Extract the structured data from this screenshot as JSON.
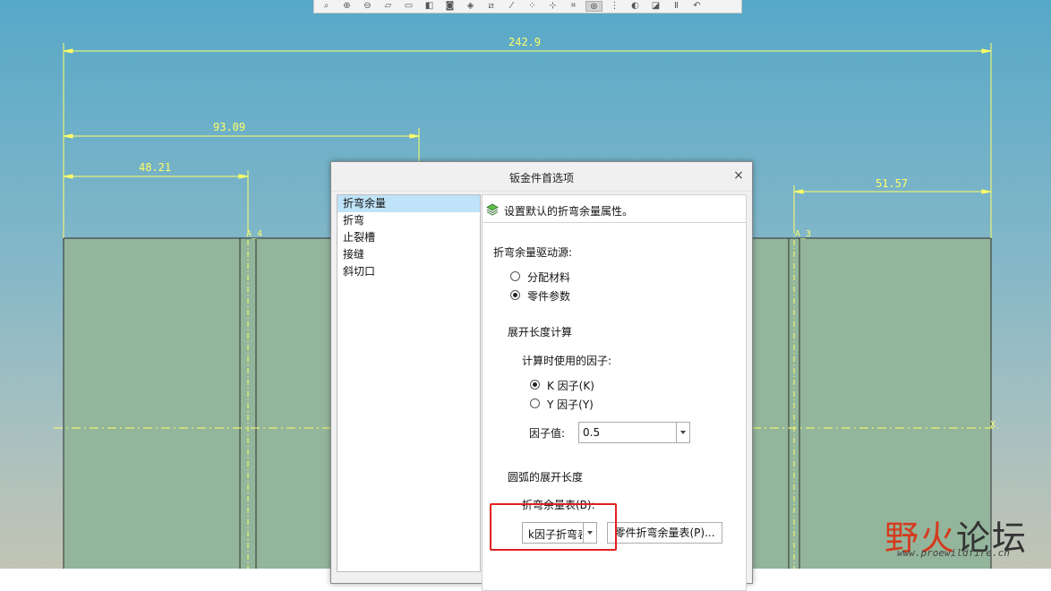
{
  "toolbar": {
    "icons": [
      "zoom-fit-icon",
      "zoom-in-icon",
      "zoom-out-icon",
      "repaint-icon",
      "saved-views-icon",
      "display-style-icon",
      "camera-icon",
      "view-manager-icon",
      "plane-display-icon",
      "axis-display-icon",
      "point-display-icon",
      "csys-display-icon",
      "annotation-display-icon",
      "spin-center-icon",
      "model-tree-icon",
      "appearance-icon",
      "section-icon",
      "pause-icon",
      "undo-icon"
    ]
  },
  "drawing": {
    "dims": {
      "overall": "242.9",
      "mid": "93.09",
      "left": "48.21",
      "right": "51.57"
    },
    "marker_left": "A_4",
    "marker_right": "A_3",
    "axis_label": "X",
    "colors": {
      "dimension": "#ffff66",
      "panel_fill": "#93b59b",
      "panel_stroke": "#303030"
    }
  },
  "dialog": {
    "title": "钣金件首选项",
    "close_label": "×",
    "categories": [
      "折弯余量",
      "折弯",
      "止裂槽",
      "接缝",
      "斜切口"
    ],
    "selected_category": 0,
    "header_text": "设置默认的折弯余量属性。",
    "source_label": "折弯余量驱动源:",
    "source_options": [
      "分配材料",
      "零件参数"
    ],
    "source_selected": 1,
    "develop_section": "展开长度计算",
    "factor_label": "计算时使用的因子:",
    "factor_options": [
      "K 因子(K)",
      "Y 因子(Y)"
    ],
    "factor_selected": 0,
    "factor_value_label": "因子值:",
    "factor_value": "0.5",
    "arc_section": "圆弧的展开长度",
    "table_label": "折弯余量表(B):",
    "table_value": "k因子折弯表",
    "part_table_button": "零件折弯余量表(P)..."
  },
  "watermark": {
    "text_a": "野火",
    "text_b": "论坛",
    "url": "www.proewildfire.cn"
  }
}
